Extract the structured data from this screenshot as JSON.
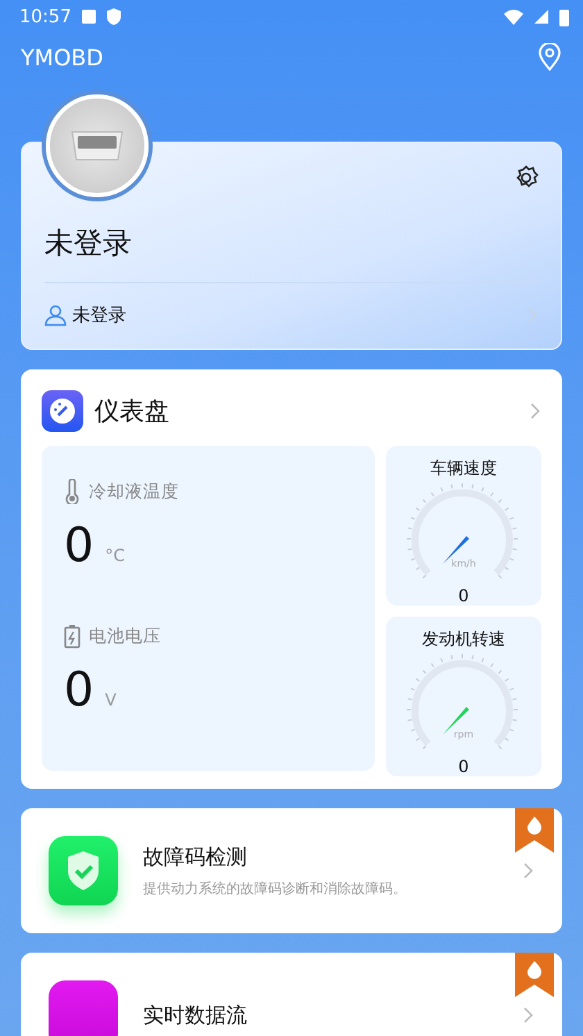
{
  "status_bar": {
    "time": "10:57"
  },
  "app_bar": {
    "title": "YMOBD"
  },
  "profile": {
    "name": "未登录",
    "account": "未登录"
  },
  "dashboard": {
    "title": "仪表盘",
    "readings": [
      {
        "kind": "temperature",
        "label": "冷却液温度",
        "value": "0",
        "unit": "°C"
      },
      {
        "kind": "battery",
        "label": "电池电压",
        "value": "0",
        "unit": "V"
      }
    ],
    "gauges": [
      {
        "label": "车辆速度",
        "unit": "km/h",
        "value": "0",
        "color": "#1f6fe0"
      },
      {
        "label": "发动机转速",
        "unit": "rpm",
        "value": "0",
        "color": "#22d45a"
      }
    ]
  },
  "features": [
    {
      "kind": "shield",
      "title": "故障码检测",
      "description": "提供动力系统的故障码诊断和消除故障码。"
    },
    {
      "kind": "stream",
      "title": "实时数据流"
    }
  ]
}
